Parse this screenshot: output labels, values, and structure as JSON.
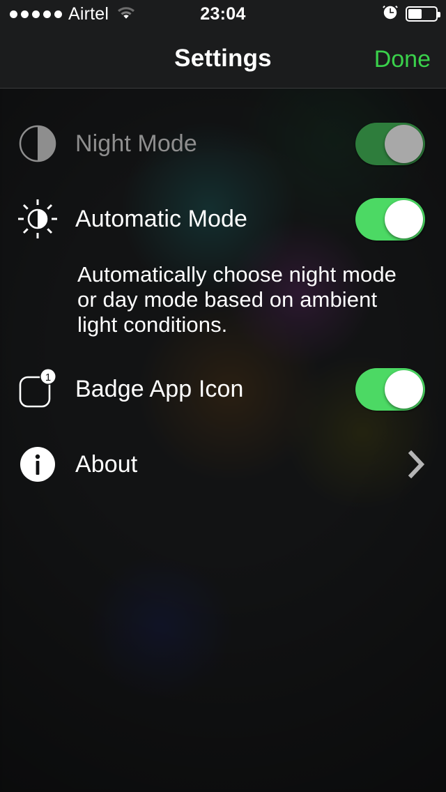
{
  "status_bar": {
    "signal_dots_total": 5,
    "signal_dots_filled": 5,
    "carrier": "Airtel",
    "wifi_icon": "wifi-icon",
    "time": "23:04",
    "alarm_icon": "alarm-clock-icon",
    "battery_icon": "battery-icon",
    "battery_percent": 45
  },
  "nav": {
    "title": "Settings",
    "done_label": "Done"
  },
  "rows": {
    "night_mode": {
      "label": "Night Mode",
      "icon": "half-moon-contrast-icon",
      "switch_state": "on",
      "enabled": false
    },
    "automatic_mode": {
      "label": "Automatic Mode",
      "icon": "brightness-sun-icon",
      "switch_state": "on",
      "enabled": true
    },
    "badge_app_icon": {
      "label": "Badge App Icon",
      "icon": "app-badge-icon",
      "badge_count": "1",
      "switch_state": "on",
      "enabled": true
    },
    "about": {
      "label": "About",
      "icon": "info-circle-icon",
      "accessory": "chevron-right-icon"
    }
  },
  "description": {
    "text": "Automatically choose night mode or day mode based on ambient light conditions."
  },
  "colors": {
    "switch_on": "#4cd964",
    "switch_disabled_track": "#2e7d3c",
    "switch_disabled_knob": "#a8a8a8",
    "done_green": "#3ad14b",
    "disabled_label": "#8e8e8e",
    "background": "#121314",
    "bar_background": "#1b1c1d"
  }
}
